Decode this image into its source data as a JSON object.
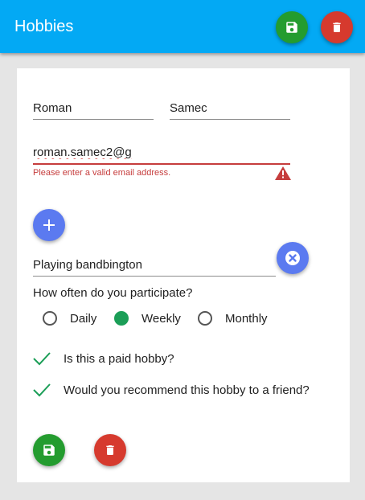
{
  "app": {
    "title": "Hobbies",
    "colors": {
      "primary": "#03a9f4",
      "save": "#249c2f",
      "delete": "#d63a2e",
      "add": "#5b7af0",
      "error": "#c63d3d",
      "check": "#1b9e57"
    }
  },
  "header": {
    "save_icon": "floppy-disk-icon",
    "delete_icon": "trash-icon"
  },
  "form": {
    "first_name": "Roman",
    "last_name": "Samec",
    "email": "roman.samec2@g",
    "email_error": "Please enter a valid email address.",
    "add_icon": "plus-icon"
  },
  "hobby": {
    "name": "Playing bandbington",
    "remove_icon": "close-circle-icon",
    "question": "How often do you participate?",
    "frequency_options": [
      {
        "label": "Daily",
        "selected": false
      },
      {
        "label": "Weekly",
        "selected": true
      },
      {
        "label": "Monthly",
        "selected": false
      }
    ],
    "checks": [
      {
        "label": "Is this a paid hobby?",
        "checked": true
      },
      {
        "label": "Would you recommend this hobby to a friend?",
        "checked": true
      }
    ]
  },
  "footer": {
    "save_icon": "floppy-disk-icon",
    "delete_icon": "trash-icon"
  }
}
